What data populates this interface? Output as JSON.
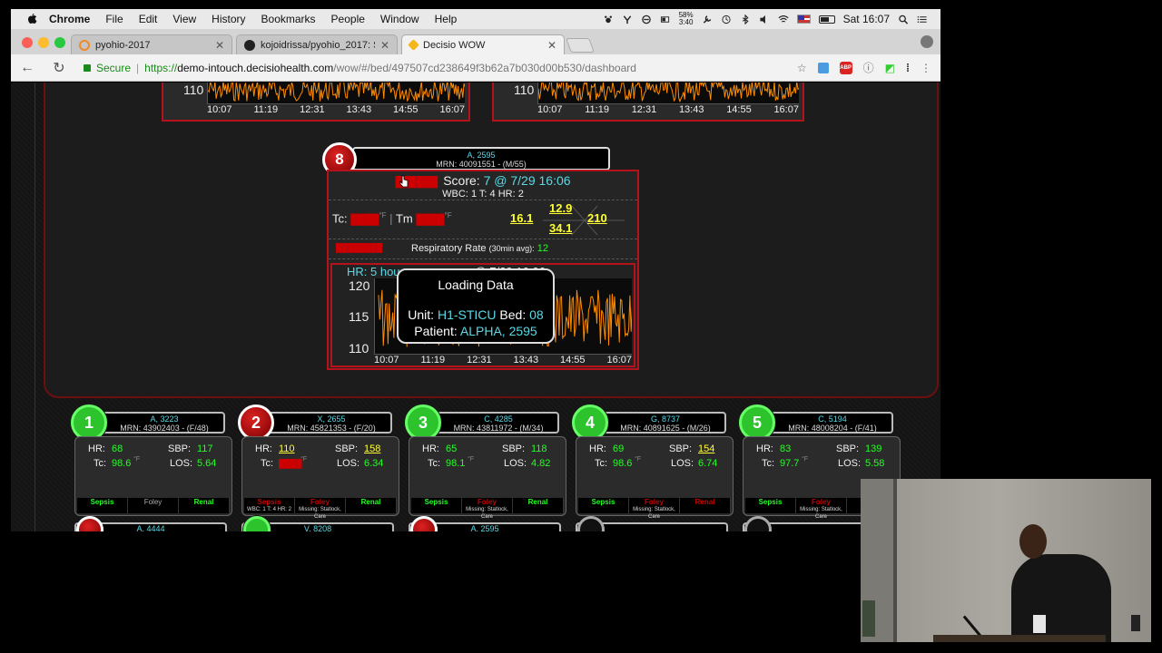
{
  "menubar": {
    "app": "Chrome",
    "items": [
      "File",
      "Edit",
      "View",
      "History",
      "Bookmarks",
      "People",
      "Window",
      "Help"
    ],
    "battery_pct": "58%",
    "battery_time": "3:40",
    "clock": "Sat 16:07"
  },
  "tabs": [
    {
      "title": "pyohio-2017",
      "color": "#f08a24"
    },
    {
      "title": "kojoidrissa/pyohio_2017: Slid",
      "color": "#222222"
    },
    {
      "title": "Decisio WOW",
      "color": "#f3b81b"
    }
  ],
  "address": {
    "secure_label": "Secure",
    "url_scheme": "https://",
    "url_host": "demo-intouch.decisiohealth.com",
    "url_path": "/wow/#/bed/497507cd238649f3b62a7b030d00b530/dashboard"
  },
  "top_charts": {
    "ylabel": "110",
    "times": [
      "10:07",
      "11:19",
      "12:31",
      "13:43",
      "14:55",
      "16:07"
    ]
  },
  "bed8": {
    "number": "8",
    "name": "A, 2595",
    "mrn": "MRN: 40091551 - (M/55)",
    "score_prefix": "Score: ",
    "score": "7 @ 7/29 16:06",
    "wbc_line": "WBC: 1 T: 4 HR: 2",
    "tc_label": "Tc:",
    "tm_label": "Tm",
    "wbc_val": "16.1",
    "hgb_val": "12.9",
    "hct_val": "34.1",
    "plt_val": "210",
    "resp_label": "Respiratory Rate",
    "resp_sub": "(30min avg):",
    "resp_val": "12",
    "hr_title": "HR: 5 hou",
    "hr_title_tail": "@ 7/29 16:06",
    "yticks": [
      "120",
      "115",
      "110"
    ],
    "times": [
      "10:07",
      "11:19",
      "12:31",
      "13:43",
      "14:55",
      "16:07"
    ]
  },
  "loading": {
    "title": "Loading Data",
    "unit_label": "Unit:",
    "unit": "H1-STICU",
    "bed_label": "Bed:",
    "bed": "08",
    "patient_label": "Patient:",
    "patient": "ALPHA, 2595"
  },
  "labels": {
    "hr": "HR:",
    "sbp": "SBP:",
    "tc": "Tc:",
    "los": "LOS:"
  },
  "patients": [
    {
      "num": "1",
      "name": "A, 3223",
      "mrn": "MRN: 43902403 - (F/48)",
      "hr": "68",
      "sbp": "117",
      "tc": "98.6",
      "los": "5.64",
      "flags": [
        {
          "t": "Sepsis",
          "c": "green"
        },
        {
          "t": "Foley",
          "c": "grey"
        },
        {
          "t": "Renal",
          "c": "green"
        }
      ]
    },
    {
      "num": "2",
      "name": "X, 2655",
      "mrn": "MRN: 45821353 - (F/20)",
      "hr": "110",
      "sbp": "158",
      "tc": "",
      "los": "6.34",
      "flags": [
        {
          "t": "Sepsis",
          "c": "red",
          "s": "WBC: 1 T: 4 HR: 2"
        },
        {
          "t": "Foley",
          "c": "red",
          "s": "Missing: Statlock, Care"
        },
        {
          "t": "Renal",
          "c": "green"
        }
      ]
    },
    {
      "num": "3",
      "name": "C, 4285",
      "mrn": "MRN: 43811972 - (M/34)",
      "hr": "65",
      "sbp": "118",
      "tc": "98.1",
      "los": "4.82",
      "flags": [
        {
          "t": "Sepsis",
          "c": "green"
        },
        {
          "t": "Foley",
          "c": "red",
          "s": "Missing: Statlock, Care"
        },
        {
          "t": "Renal",
          "c": "green"
        }
      ]
    },
    {
      "num": "4",
      "name": "G, 8737",
      "mrn": "MRN: 40891625 - (M/26)",
      "hr": "69",
      "sbp": "154",
      "tc": "98.6",
      "los": "6.74",
      "flags": [
        {
          "t": "Sepsis",
          "c": "green"
        },
        {
          "t": "Foley",
          "c": "red",
          "s": "Missing: Statlock, Care"
        },
        {
          "t": "Renal",
          "c": "red"
        }
      ]
    },
    {
      "num": "5",
      "name": "C, 5194",
      "mrn": "MRN: 48008204 - (F/41)",
      "hr": "83",
      "sbp": "139",
      "tc": "97.7",
      "los": "5.58",
      "flags": [
        {
          "t": "Sepsis",
          "c": "green"
        },
        {
          "t": "Foley",
          "c": "red",
          "s": "Missing: Statlock, Care"
        },
        {
          "t": "",
          "c": "grey"
        }
      ]
    }
  ],
  "partial_row": [
    "A, 4444",
    "V, 8208",
    "A, 2595"
  ],
  "colors": {
    "accent_cyan": "#59d9e6",
    "alarm_red": "#b5121b",
    "ok_green": "#2cc32c",
    "warn_yellow": "#ffff33",
    "trace_orange": "#ff8c00"
  }
}
